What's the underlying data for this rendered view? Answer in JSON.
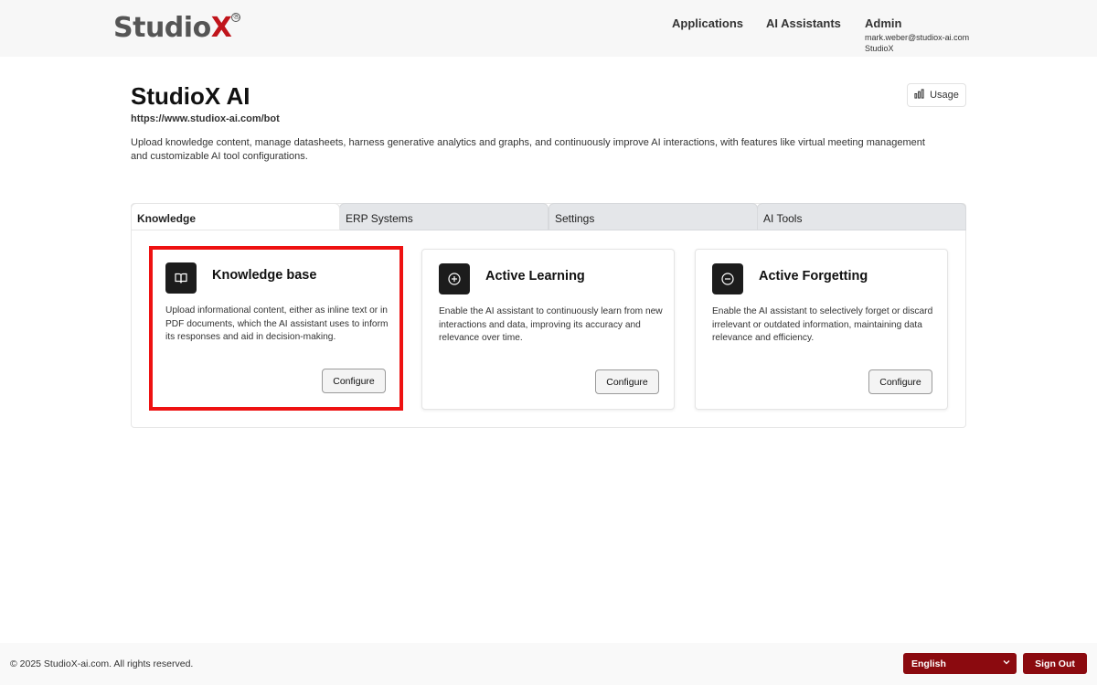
{
  "header": {
    "logo_main": "Studio",
    "logo_x": "X",
    "logo_reg": "®",
    "nav": [
      "Applications",
      "AI Assistants"
    ],
    "user": {
      "name": "Admin",
      "email": "mark.weber@studiox-ai.com",
      "org": "StudioX"
    }
  },
  "page": {
    "title": "StudioX AI",
    "url": "https://www.studiox-ai.com/bot",
    "description": "Upload knowledge content, manage datasheets, harness generative analytics and graphs, and continuously improve AI interactions, with features like virtual meeting management and customizable AI tool configurations.",
    "usage_label": "Usage"
  },
  "tabs": [
    {
      "label": "Knowledge",
      "active": true
    },
    {
      "label": "ERP Systems",
      "active": false
    },
    {
      "label": "Settings",
      "active": false
    },
    {
      "label": "AI Tools",
      "active": false
    }
  ],
  "cards": [
    {
      "icon": "book-icon",
      "title": "Knowledge base",
      "description": "Upload informational content, either as inline text or in PDF documents, which the AI assistant uses to inform its responses and aid in decision-making.",
      "button": "Configure",
      "highlighted": true
    },
    {
      "icon": "plus-circle-icon",
      "title": "Active Learning",
      "description": "Enable the AI assistant to continuously learn from new interactions and data, improving its accuracy and relevance over time.",
      "button": "Configure",
      "highlighted": false
    },
    {
      "icon": "minus-circle-icon",
      "title": "Active Forgetting",
      "description": "Enable the AI assistant to selectively forget or discard irrelevant or outdated information, maintaining data relevance and efficiency.",
      "button": "Configure",
      "highlighted": false
    }
  ],
  "footer": {
    "copyright": "© 2025 StudioX-ai.com.  All rights reserved.",
    "language": "English",
    "signout": "Sign Out"
  },
  "colors": {
    "brand_red": "#c0141b",
    "button_red": "#8b0a0f",
    "highlight_red": "#ee1111",
    "icon_bg": "#1c1c1c"
  }
}
